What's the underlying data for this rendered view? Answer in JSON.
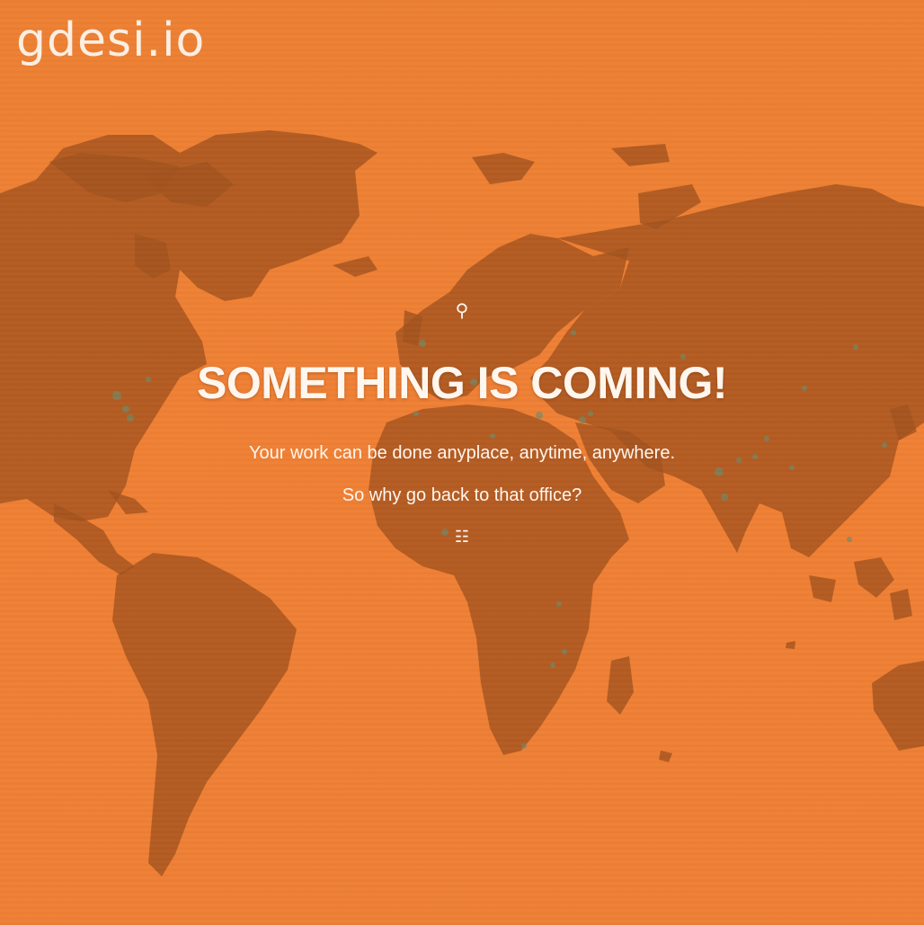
{
  "brand": {
    "logo_text": "gdesi.io"
  },
  "hero": {
    "pin_glyph": "⚲",
    "headline": "SOMETHING IS COMING!",
    "tagline_1": "Your work can be done anyplace, anytime, anywhere.",
    "tagline_2": "So why go back to that office?",
    "menu_glyph": "☷"
  },
  "icons": {
    "pin": "map-pin-icon",
    "menu": "menu-grid-icon"
  },
  "colors": {
    "background": "#ee8033",
    "land": "#a2521f",
    "text": "#fff6ee"
  }
}
